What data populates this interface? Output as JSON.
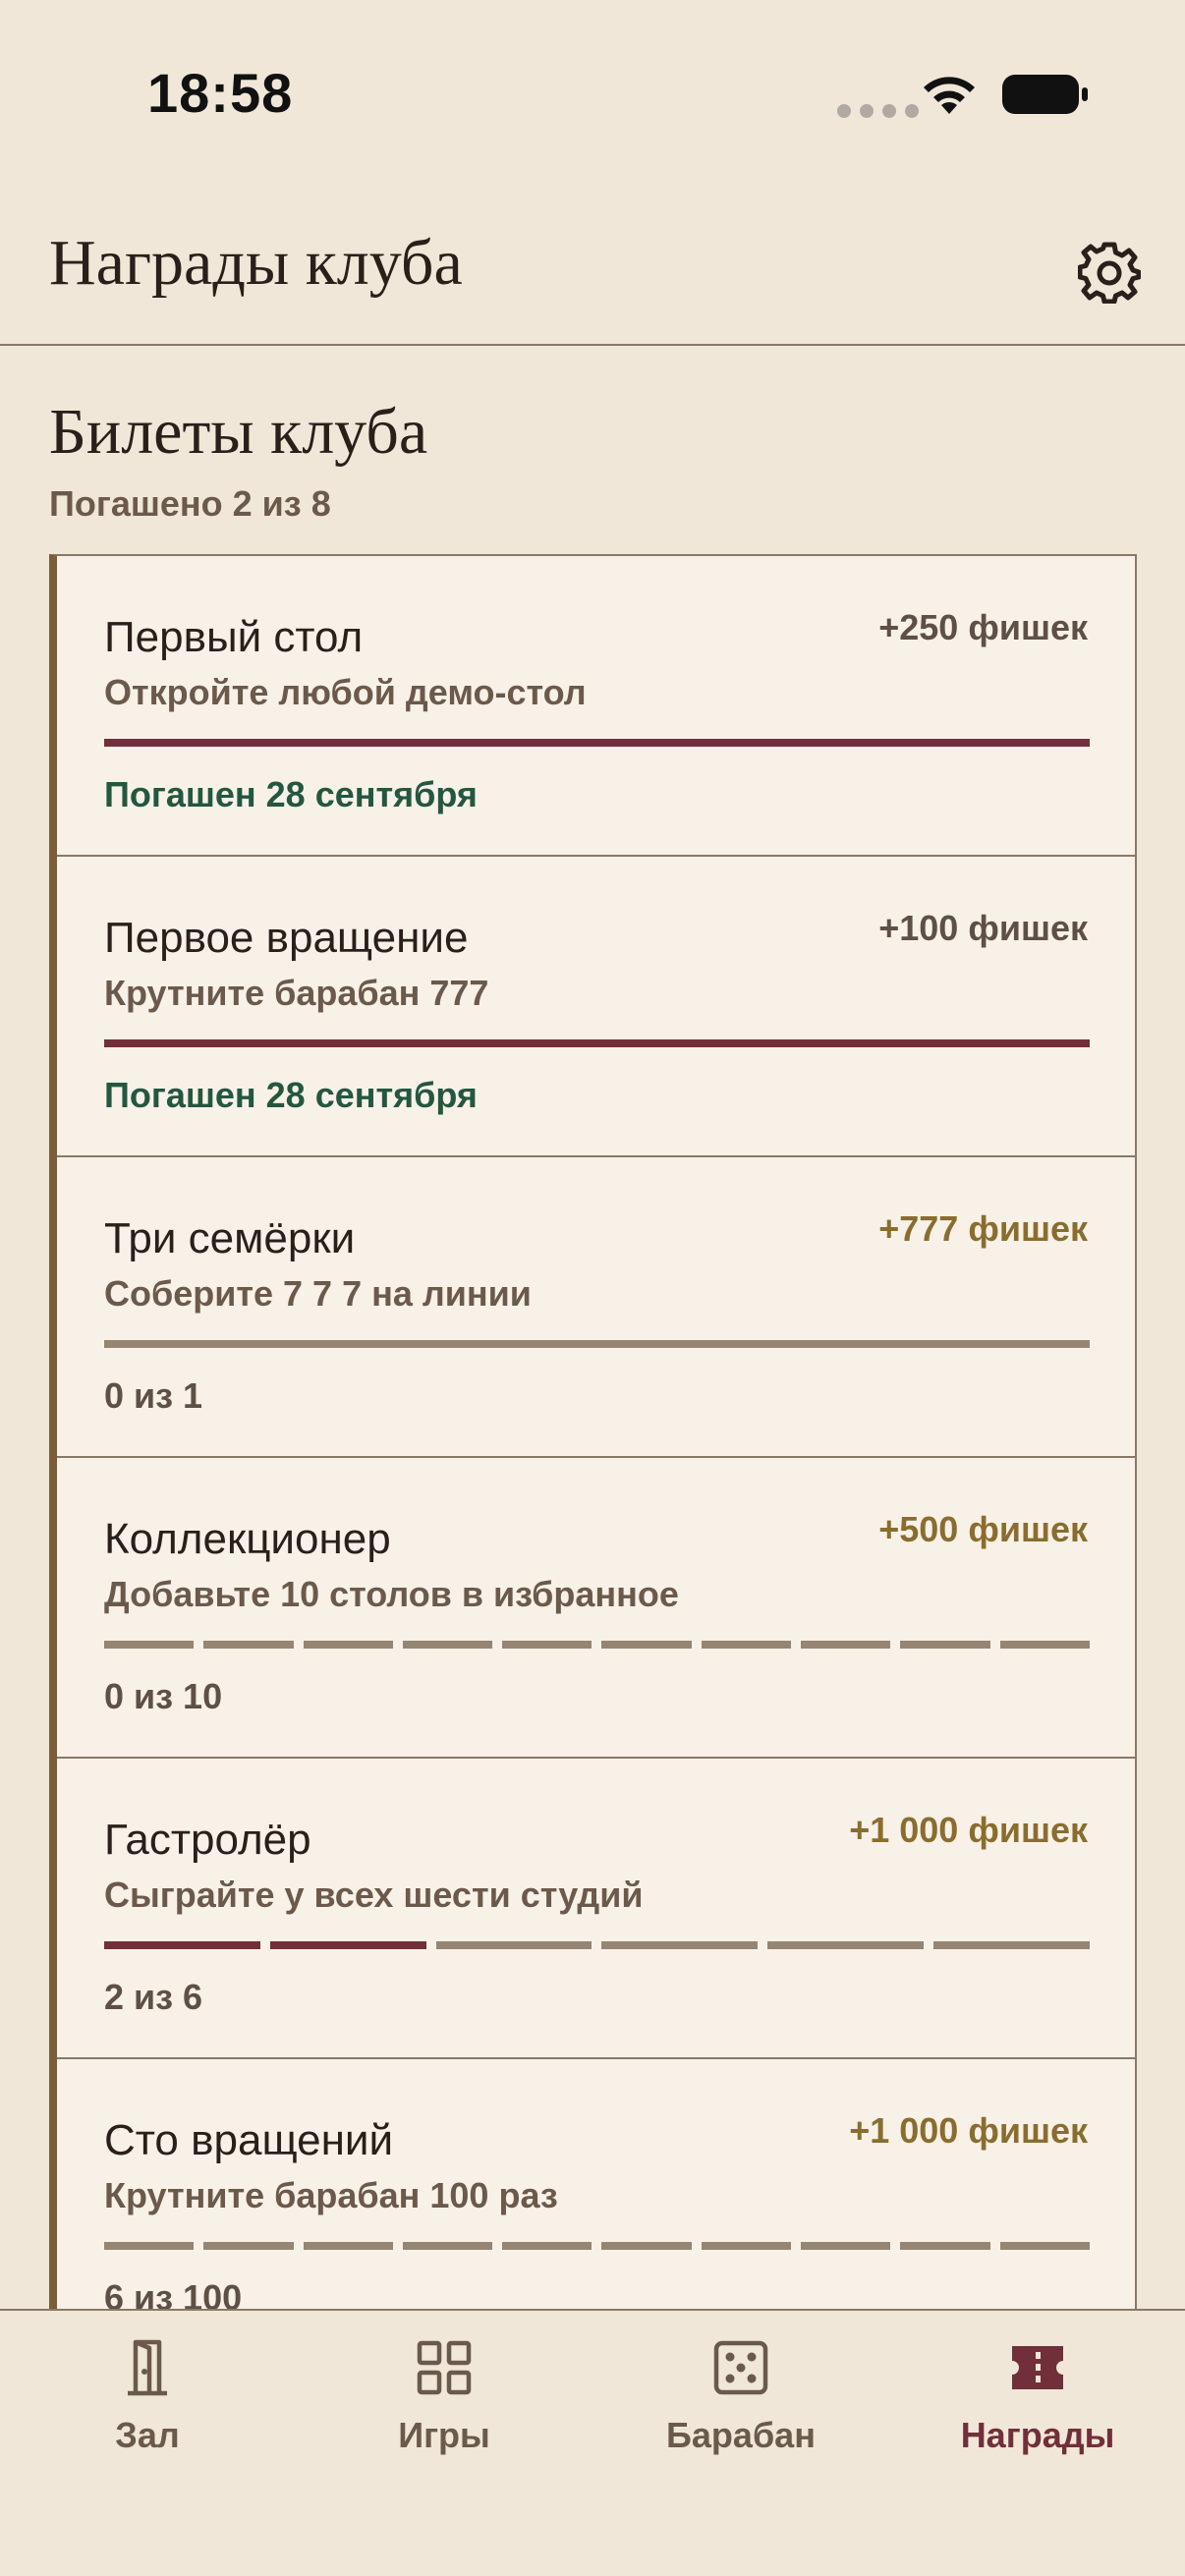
{
  "status_bar": {
    "time": "18:58"
  },
  "header": {
    "title": "Награды клуба"
  },
  "section": {
    "title": "Билеты клуба",
    "subtitle": "Погашено 2 из 8"
  },
  "tickets": [
    {
      "name": "Первый стол",
      "reward": "+250 фишек",
      "description": "Откройте любой демо-стол",
      "status": "Погашен 28 сентября",
      "redeemed": true,
      "progress_done": 1,
      "progress_total": 1
    },
    {
      "name": "Первое вращение",
      "reward": "+100 фишек",
      "description": "Крутните барабан 777",
      "status": "Погашен 28 сентября",
      "redeemed": true,
      "progress_done": 1,
      "progress_total": 1
    },
    {
      "name": "Три семёрки",
      "reward": "+777 фишек",
      "description": "Соберите 7 7 7 на линии",
      "status": "0 из 1",
      "redeemed": false,
      "progress_done": 0,
      "progress_total": 1
    },
    {
      "name": "Коллекционер",
      "reward": "+500 фишек",
      "description": "Добавьте 10 столов в избранное",
      "status": "0 из 10",
      "redeemed": false,
      "progress_done": 0,
      "progress_total": 10
    },
    {
      "name": "Гастролёр",
      "reward": "+1 000 фишек",
      "description": "Сыграйте у всех шести студий",
      "status": "2 из 6",
      "redeemed": false,
      "progress_done": 2,
      "progress_total": 6
    },
    {
      "name": "Сто вращений",
      "reward": "+1 000 фишек",
      "description": "Крутните барабан 100 раз",
      "status": "6 из 100",
      "redeemed": false,
      "progress_done": 6,
      "progress_total": 100,
      "progress_segments": 10
    }
  ],
  "tabs": [
    {
      "label": "Зал",
      "icon": "door-icon",
      "active": false
    },
    {
      "label": "Игры",
      "icon": "grid-icon",
      "active": false
    },
    {
      "label": "Барабан",
      "icon": "dice-icon",
      "active": false
    },
    {
      "label": "Награды",
      "icon": "ticket-icon",
      "active": true
    }
  ],
  "colors": {
    "background": "#f0e7d8",
    "card": "#f8f1e8",
    "accent": "#712f3b",
    "redeemed": "#24573f",
    "gold": "#8a6d2e",
    "muted": "#6b5a4c",
    "track": "#958572"
  }
}
